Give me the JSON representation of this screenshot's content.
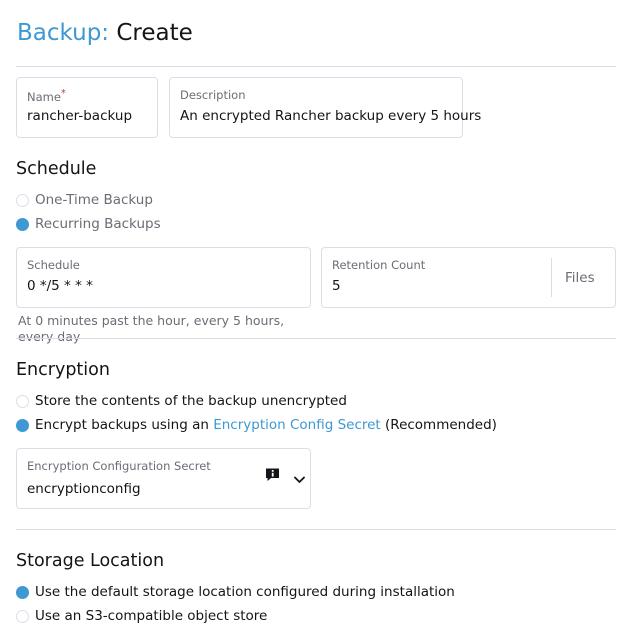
{
  "header": {
    "breadcrumb": "Backup:",
    "title": "Create"
  },
  "fields": {
    "name": {
      "label": "Name",
      "required_mark": "*",
      "value": "rancher-backup"
    },
    "description": {
      "label": "Description",
      "value": "An encrypted Rancher backup every 5 hours"
    }
  },
  "schedule": {
    "heading": "Schedule",
    "options": [
      {
        "label": "One-Time Backup",
        "selected": false
      },
      {
        "label": "Recurring Backups",
        "selected": true
      }
    ],
    "cron": {
      "label": "Schedule",
      "value": "0 */5 * * *"
    },
    "retention": {
      "label": "Retention Count",
      "value": "5",
      "suffix": "Files"
    },
    "hint": "At 0 minutes past the hour, every 5 hours, every day"
  },
  "encryption": {
    "heading": "Encryption",
    "options": [
      {
        "label": "Store the contents of the backup unencrypted",
        "selected": false
      },
      {
        "label_prefix": "Encrypt backups using an",
        "link": "Encryption Config Secret",
        "label_suffix": "(Recommended)",
        "selected": true
      }
    ],
    "secret": {
      "label": "Encryption Configuration Secret",
      "value": "encryptionconfig",
      "info_icon": "info-icon",
      "dropdown_icon": "chevron-down-icon"
    }
  },
  "storage": {
    "heading": "Storage Location",
    "options": [
      {
        "label": "Use the default storage location configured during installation",
        "selected": true
      },
      {
        "label": "Use an S3-compatible object store",
        "selected": false
      }
    ]
  },
  "colors": {
    "accent": "#3d98d3",
    "border": "#dcdee7",
    "muted_text": "#6c6c76",
    "required": "#cc3333"
  }
}
